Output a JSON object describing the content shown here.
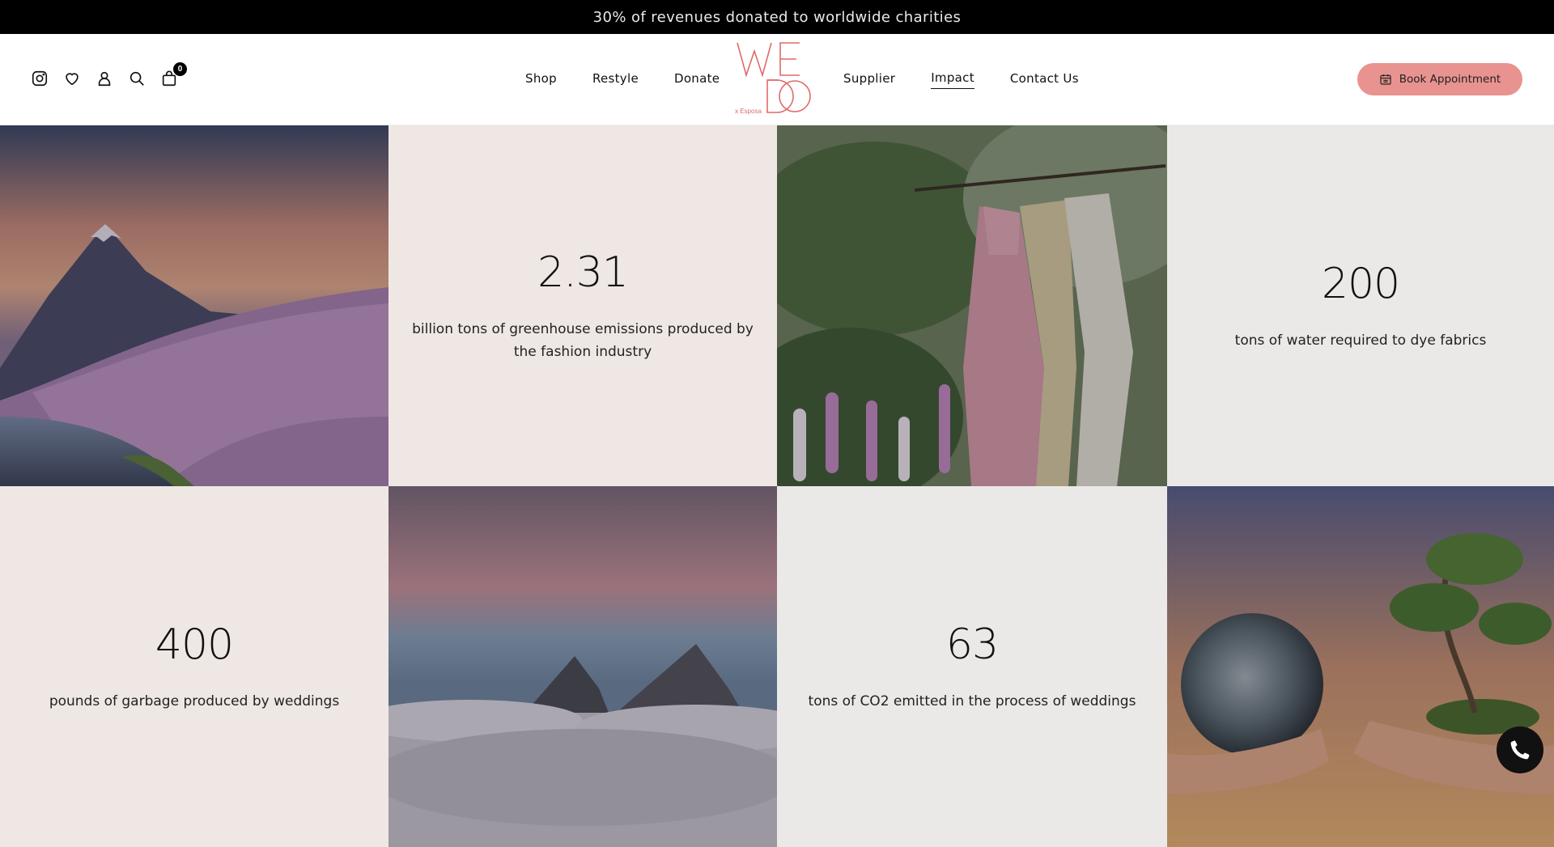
{
  "announcement": "30% of revenues donated to worldwide charities",
  "header": {
    "icons": [
      "instagram-icon",
      "heart-icon",
      "user-icon",
      "search-icon",
      "bag-icon"
    ],
    "cart_count": "0",
    "nav_left": [
      "Shop",
      "Restyle",
      "Donate"
    ],
    "nav_right": [
      "Supplier",
      "Impact",
      "Contact Us"
    ],
    "active_nav": "Impact",
    "logo": {
      "text": "WE DO",
      "sub": "x Esposa",
      "color": "#e06a67"
    },
    "book_button": "Book Appointment"
  },
  "stats": [
    {
      "value": "2.31",
      "label": "billion tons of greenhouse emissions produced by the fashion industry"
    },
    {
      "value": "200",
      "label": "tons of water required to dye fabrics"
    },
    {
      "value": "400",
      "label": "pounds of garbage produced by weddings"
    },
    {
      "value": "63",
      "label": "tons of CO2 emitted in the process of weddings"
    }
  ],
  "photos": [
    "mount-fuji-cherry-blossom",
    "dresses-in-garden",
    "mountains-above-clouds",
    "hands-earth-and-tree"
  ],
  "colors": {
    "accent": "#e8938f",
    "pink_tile": "#efe7e4",
    "grey_tile": "#ebe9e8"
  }
}
